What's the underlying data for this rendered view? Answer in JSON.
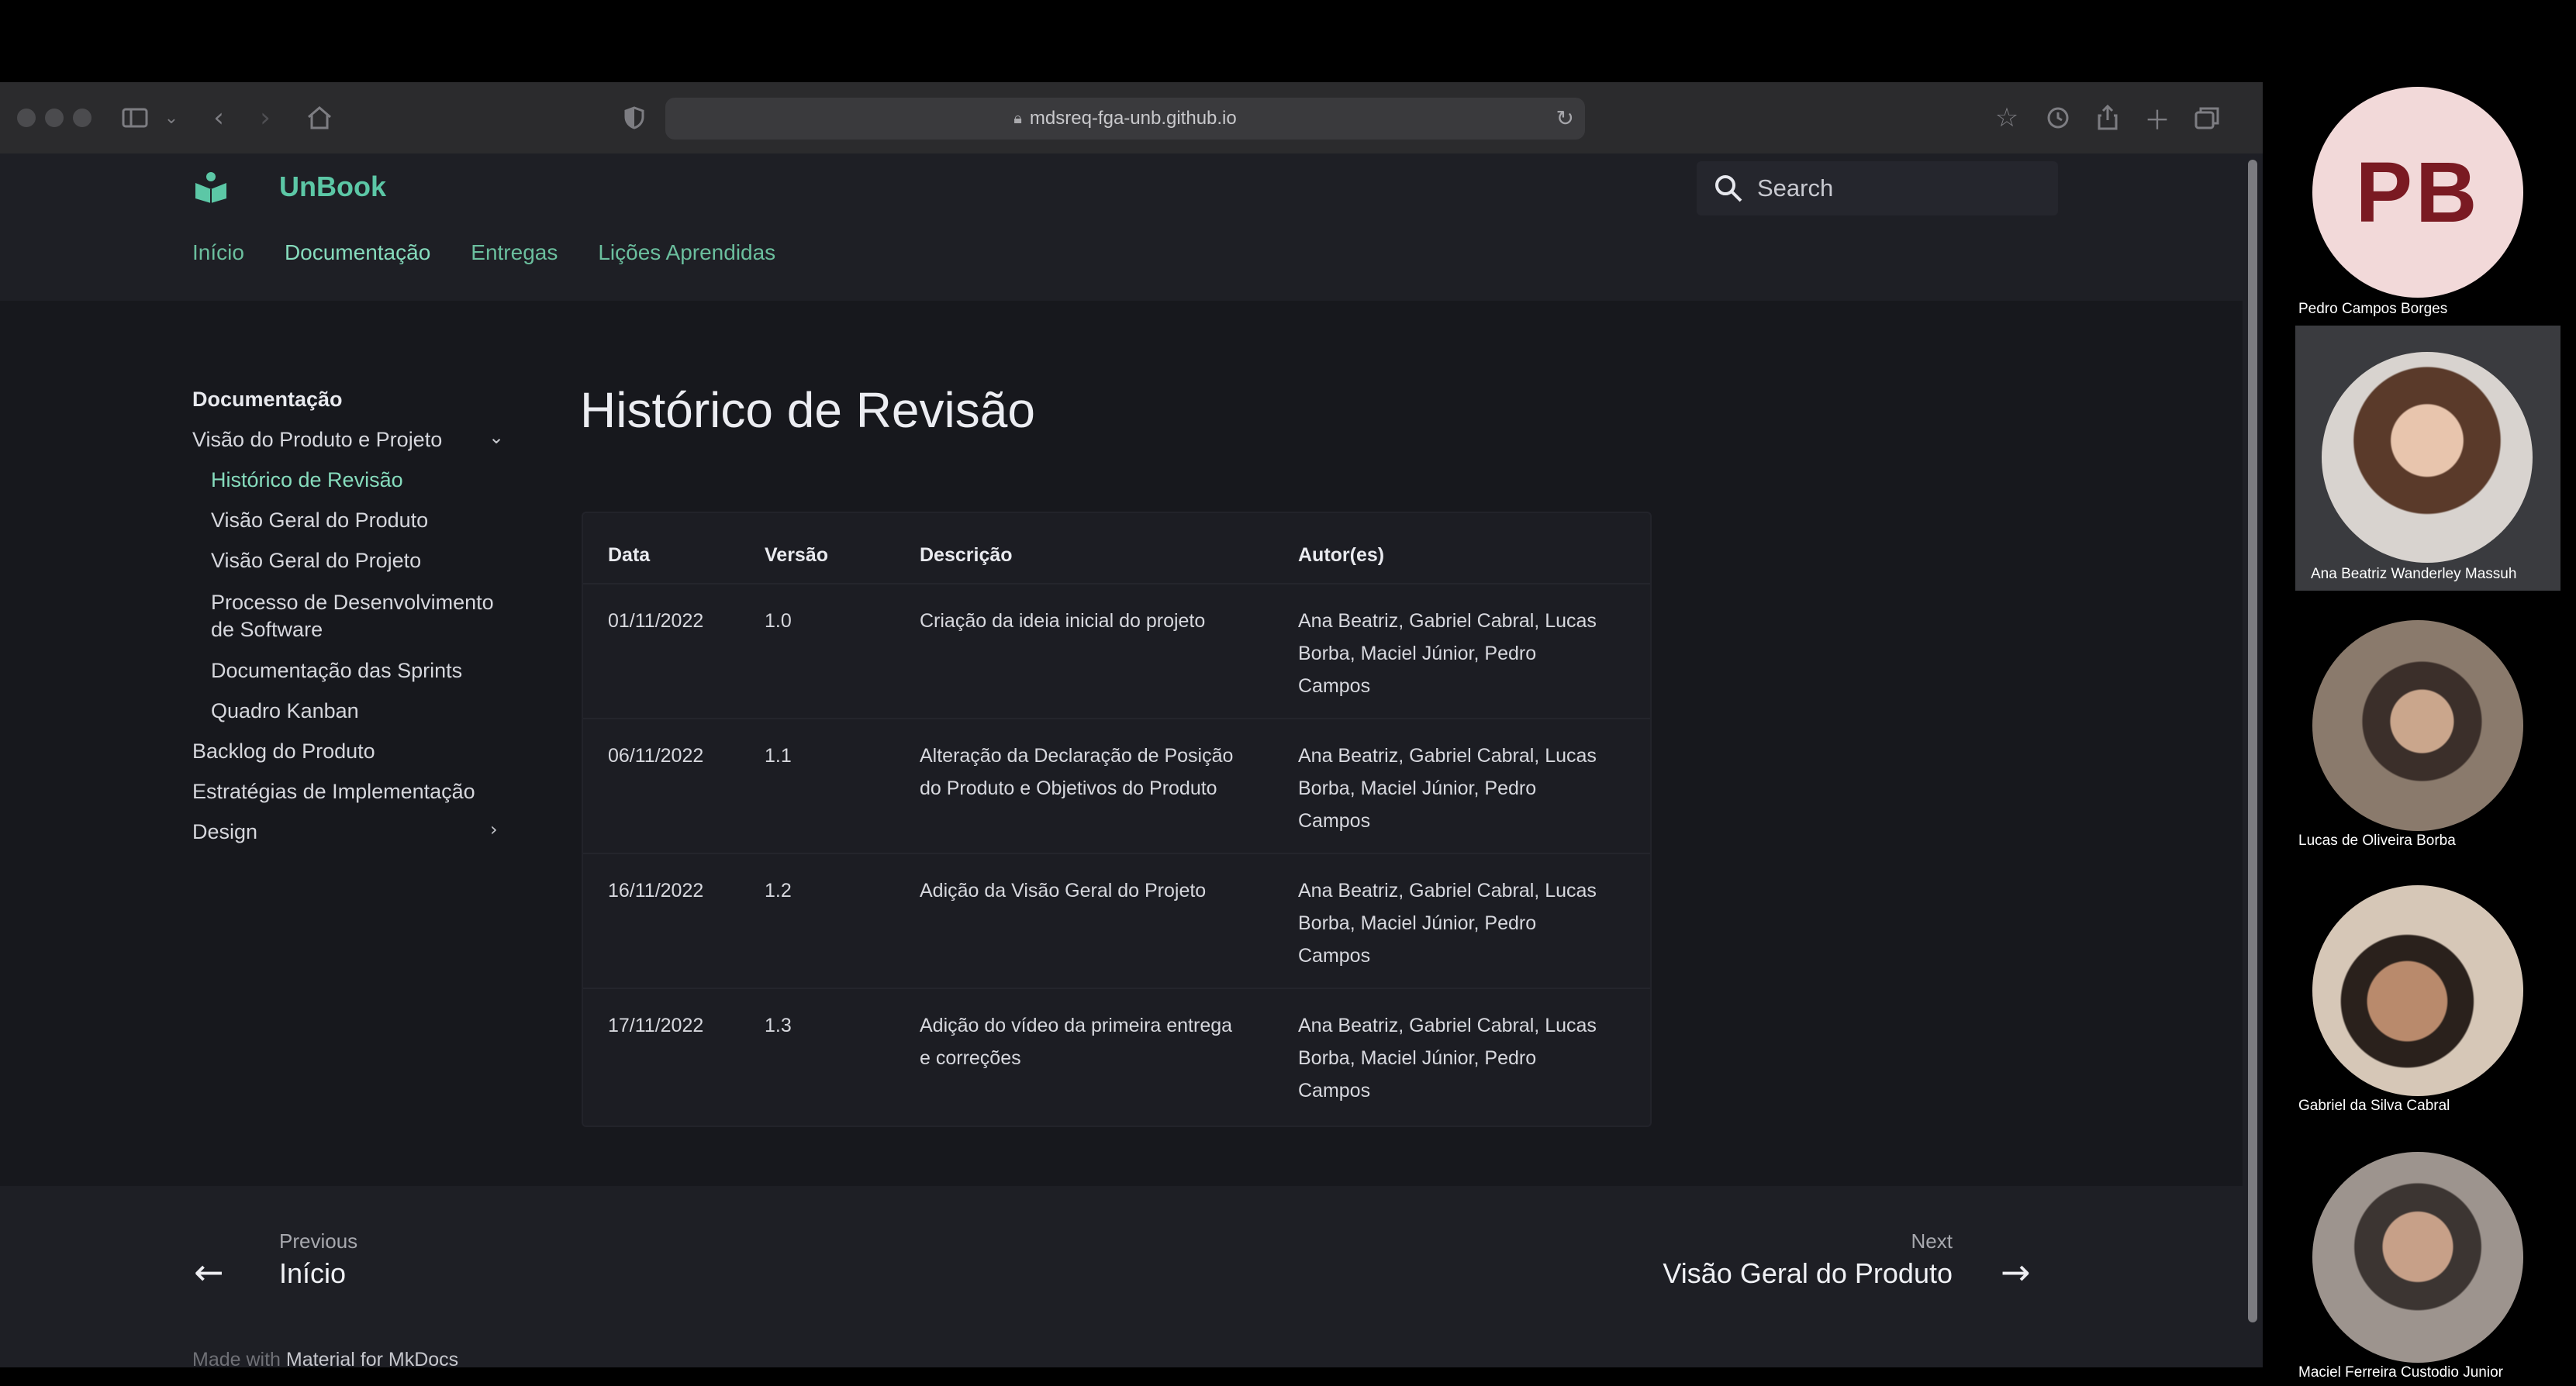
{
  "browser": {
    "url": "mdsreq-fga-unb.github.io"
  },
  "site": {
    "title": "UnBook",
    "search_placeholder": "Search",
    "tabs": [
      {
        "label": "Início"
      },
      {
        "label": "Documentação"
      },
      {
        "label": "Entregas"
      },
      {
        "label": "Lições Aprendidas"
      }
    ]
  },
  "sidebar": {
    "title": "Documentação",
    "items": [
      {
        "label": "Visão do Produto e Projeto"
      },
      {
        "label": "Histórico de Revisão"
      },
      {
        "label": "Visão Geral do Produto"
      },
      {
        "label": "Visão Geral do Projeto"
      },
      {
        "label": "Processo de Desenvolvimento",
        "label2": "de Software"
      },
      {
        "label": "Documentação das Sprints"
      },
      {
        "label": "Quadro Kanban"
      },
      {
        "label": "Backlog do Produto"
      },
      {
        "label": "Estratégias de Implementação"
      },
      {
        "label": "Design"
      }
    ]
  },
  "main": {
    "title": "Histórico de Revisão",
    "table": {
      "headers": [
        "Data",
        "Versão",
        "Descrição",
        "Autor(es)"
      ],
      "rows": [
        {
          "date": "01/11/2022",
          "version": "1.0",
          "desc": [
            "Criação da ideia inicial do projeto"
          ],
          "authors": [
            "Ana Beatriz, Gabriel Cabral, Lucas",
            "Borba, Maciel Júnior, Pedro",
            "Campos"
          ]
        },
        {
          "date": "06/11/2022",
          "version": "1.1",
          "desc": [
            "Alteração da Declaração de Posição",
            "do Produto e Objetivos do Produto"
          ],
          "authors": [
            "Ana Beatriz, Gabriel Cabral, Lucas",
            "Borba, Maciel Júnior, Pedro",
            "Campos"
          ]
        },
        {
          "date": "16/11/2022",
          "version": "1.2",
          "desc": [
            "Adição da Visão Geral do Projeto"
          ],
          "authors": [
            "Ana Beatriz, Gabriel Cabral, Lucas",
            "Borba, Maciel Júnior, Pedro",
            "Campos"
          ]
        },
        {
          "date": "17/11/2022",
          "version": "1.3",
          "desc": [
            "Adição do vídeo da primeira entrega",
            "e correções"
          ],
          "authors": [
            "Ana Beatriz, Gabriel Cabral, Lucas",
            "Borba, Maciel Júnior, Pedro",
            "Campos"
          ]
        }
      ]
    }
  },
  "footer": {
    "prev_small": "Previous",
    "prev_title": "Início",
    "next_small": "Next",
    "next_title": "Visão Geral do Produto",
    "made_prefix": "Made with",
    "made_link": "Material for MkDocs"
  },
  "call": {
    "participants": [
      {
        "name": "Pedro Campos Borges",
        "initials": "PB"
      },
      {
        "name": "Ana Beatriz Wanderley Massuh"
      },
      {
        "name": "Lucas de Oliveira Borba"
      },
      {
        "name": "Gabriel da Silva Cabral"
      },
      {
        "name": "Maciel Ferreira Custodio Junior"
      }
    ]
  },
  "colors": {
    "accent": "#5cc7a6",
    "page_bg": "#17181d",
    "header_bg": "#1e1f25"
  }
}
